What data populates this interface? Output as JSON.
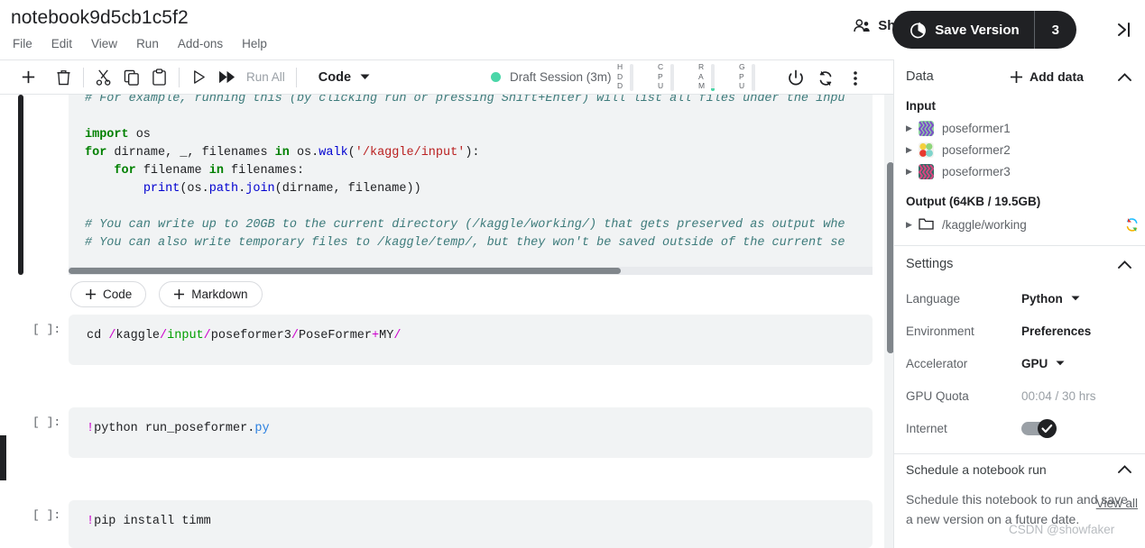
{
  "header": {
    "notebook_title": "notebook9d5cb1c5f2",
    "menu": [
      "File",
      "Edit",
      "View",
      "Run",
      "Add-ons",
      "Help"
    ],
    "share_label": "Share",
    "save_version_label": "Save Version",
    "save_version_count": "3",
    "share_icon": "people-icon",
    "save_version_icon": "clock-pie-icon",
    "collapse_icon": "collapse-right-icon"
  },
  "toolbar": {
    "buttons": [
      {
        "name": "add-cell-button",
        "icon": "plus-icon"
      },
      {
        "name": "delete-cell-button",
        "icon": "trash-icon"
      },
      {
        "name": "cut-button",
        "icon": "scissors-icon"
      },
      {
        "name": "copy-button",
        "icon": "copy-icon"
      },
      {
        "name": "paste-button",
        "icon": "clipboard-icon"
      },
      {
        "name": "run-button",
        "icon": "play-icon"
      },
      {
        "name": "run-advance-button",
        "icon": "play-double-icon"
      }
    ],
    "run_all_label": "Run All",
    "cell_type": "Code",
    "cell_type_icon": "chevron-down-icon",
    "session_status": "Draft Session (3m)",
    "session_dot_color": "#4ad6a8",
    "meters": [
      {
        "label": "HDD",
        "fill_pct": 0
      },
      {
        "label": "CPU",
        "fill_pct": 0
      },
      {
        "label": "RAM",
        "fill_pct": 8
      },
      {
        "label": "GPU",
        "fill_pct": 0
      }
    ],
    "right_icons": [
      {
        "name": "power-button",
        "icon": "power-icon"
      },
      {
        "name": "restart-button",
        "icon": "refresh-icon"
      },
      {
        "name": "more-options-button",
        "icon": "kebab-menu-icon"
      }
    ]
  },
  "editor": {
    "add_code_label": "+ Code",
    "add_markdown_label": "+ Markdown",
    "cells": [
      {
        "gutter": "",
        "lines": [
          {
            "segments": [
              {
                "t": "# For example, running this (by clicking run or pressing Shift+Enter) will list all files under the inpu",
                "c": "tok-cmt"
              }
            ]
          },
          {
            "segments": [
              {
                "t": "",
                "c": ""
              }
            ]
          },
          {
            "segments": [
              {
                "t": "import",
                "c": "tok-kw"
              },
              {
                "t": " os",
                "c": ""
              }
            ]
          },
          {
            "segments": [
              {
                "t": "for",
                "c": "tok-kw"
              },
              {
                "t": " dirname, _, filenames ",
                "c": ""
              },
              {
                "t": "in",
                "c": "tok-kw"
              },
              {
                "t": " os.",
                "c": ""
              },
              {
                "t": "walk",
                "c": "tok-fn"
              },
              {
                "t": "(",
                "c": ""
              },
              {
                "t": "'/kaggle/input'",
                "c": "tok-str"
              },
              {
                "t": "):",
                "c": ""
              }
            ]
          },
          {
            "segments": [
              {
                "t": "    ",
                "c": ""
              },
              {
                "t": "for",
                "c": "tok-kw"
              },
              {
                "t": " filename ",
                "c": ""
              },
              {
                "t": "in",
                "c": "tok-kw"
              },
              {
                "t": " filenames:",
                "c": ""
              }
            ]
          },
          {
            "segments": [
              {
                "t": "        ",
                "c": ""
              },
              {
                "t": "print",
                "c": "tok-fn"
              },
              {
                "t": "(os.",
                "c": ""
              },
              {
                "t": "path",
                "c": "tok-fn"
              },
              {
                "t": ".",
                "c": ""
              },
              {
                "t": "join",
                "c": "tok-fn"
              },
              {
                "t": "(dirname, filename))",
                "c": ""
              }
            ]
          },
          {
            "segments": [
              {
                "t": "",
                "c": ""
              }
            ]
          },
          {
            "segments": [
              {
                "t": "# You can write up to 20GB to the current directory (/kaggle/working/) that gets preserved as output whe",
                "c": "tok-cmt"
              }
            ]
          },
          {
            "segments": [
              {
                "t": "# You can also write temporary files to /kaggle/temp/, but they won't be saved outside of the current se",
                "c": "tok-cmt"
              }
            ]
          }
        ]
      },
      {
        "gutter": "[ ]:",
        "lines": [
          {
            "segments": [
              {
                "t": "cd ",
                "c": ""
              },
              {
                "t": "/",
                "c": "tok-magenta"
              },
              {
                "t": "kaggle",
                "c": ""
              },
              {
                "t": "/",
                "c": "tok-magenta"
              },
              {
                "t": "input",
                "c": "tok-green"
              },
              {
                "t": "/",
                "c": "tok-magenta"
              },
              {
                "t": "poseformer3",
                "c": ""
              },
              {
                "t": "/",
                "c": "tok-magenta"
              },
              {
                "t": "PoseFormer",
                "c": ""
              },
              {
                "t": "+",
                "c": "tok-magenta"
              },
              {
                "t": "MY",
                "c": ""
              },
              {
                "t": "/",
                "c": "tok-magenta"
              }
            ]
          }
        ]
      },
      {
        "gutter": "[ ]:",
        "lines": [
          {
            "segments": [
              {
                "t": "!",
                "c": "tok-magenta"
              },
              {
                "t": "python run_poseformer",
                "c": ""
              },
              {
                "t": ".",
                "c": ""
              },
              {
                "t": "py",
                "c": "tok-blue"
              }
            ]
          }
        ]
      },
      {
        "gutter": "[ ]:",
        "lines": [
          {
            "segments": [
              {
                "t": "!",
                "c": "tok-magenta"
              },
              {
                "t": "pip install timm",
                "c": ""
              }
            ]
          }
        ]
      }
    ]
  },
  "sidebar": {
    "data_section": {
      "title": "Data",
      "add_data_label": "Add data",
      "add_data_icon": "plus-icon",
      "collapse_icon": "chevron-up-icon",
      "input_label": "Input",
      "inputs": [
        {
          "name": "poseformer1",
          "icon": "dataset-icon"
        },
        {
          "name": "poseformer2",
          "icon": "dataset-icon"
        },
        {
          "name": "poseformer3",
          "icon": "dataset-icon"
        }
      ],
      "output_label": "Output (64KB / 19.5GB)",
      "output_items": [
        {
          "name": "/kaggle/working",
          "icon": "folder-icon",
          "refresh_icon": "refresh-icon"
        }
      ]
    },
    "settings_section": {
      "title": "Settings",
      "collapse_icon": "chevron-up-icon",
      "rows": [
        {
          "label": "Language",
          "value": "Python",
          "type": "dropdown"
        },
        {
          "label": "Environment",
          "value": "Preferences",
          "type": "link"
        },
        {
          "label": "Accelerator",
          "value": "GPU",
          "type": "dropdown"
        },
        {
          "label": "GPU Quota",
          "value": "00:04 / 30 hrs",
          "type": "plain"
        },
        {
          "label": "Internet",
          "value": "on",
          "type": "toggle"
        }
      ]
    },
    "schedule_section": {
      "title": "Schedule a notebook run",
      "collapse_icon": "chevron-up-icon",
      "description": "Schedule this notebook to run and save a new version on a future date.",
      "view_all_label": "View all"
    }
  },
  "watermark": "CSDN @showfaker"
}
